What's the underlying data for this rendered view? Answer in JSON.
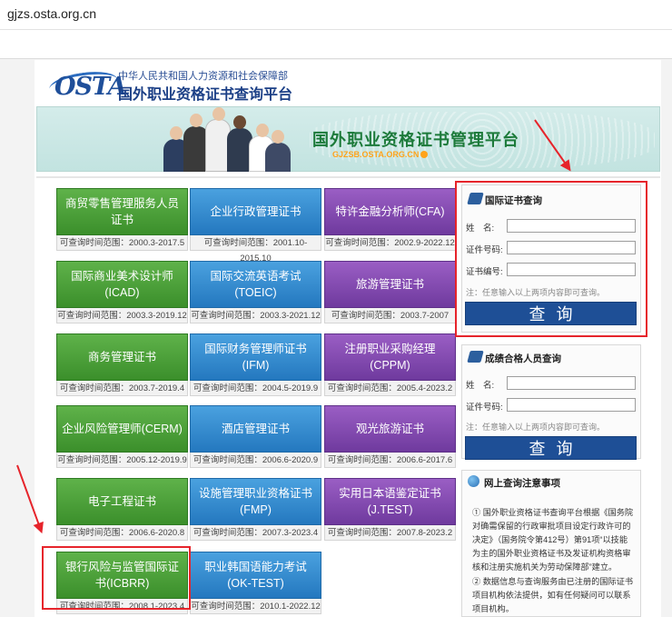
{
  "browser": {
    "url": "gjzs.osta.org.cn"
  },
  "header": {
    "logo_text": "OSTA",
    "department": "中华人民共和国人力资源和社会保障部",
    "platform": "国外职业资格证书查询平台"
  },
  "banner": {
    "title": "国外职业资格证书管理平台",
    "url": "GJZSB.OSTA.ORG.CN"
  },
  "tiles": [
    {
      "label": "商贸零售管理服务人员证书",
      "range": "可查询时间范围：2000.3-2017.5",
      "color": "green"
    },
    {
      "label": "企业行政管理证书",
      "range": "可查询时间范围：2001.10-2015.10",
      "color": "blue"
    },
    {
      "label": "特许金融分析师(CFA)",
      "range": "可查询时间范围：2002.9-2022.12",
      "color": "purple"
    },
    {
      "label": "国际商业美术设计师(ICAD)",
      "range": "可查询时间范围：2003.3-2019.12",
      "color": "green"
    },
    {
      "label": "国际交流英语考试(TOEIC)",
      "range": "可查询时间范围：2003.3-2021.12",
      "color": "blue"
    },
    {
      "label": "旅游管理证书",
      "range": "可查询时间范围：2003.7-2007",
      "color": "purple"
    },
    {
      "label": "商务管理证书",
      "range": "可查询时间范围：2003.7-2019.4",
      "color": "green"
    },
    {
      "label": "国际财务管理师证书(IFM)",
      "range": "可查询时间范围：2004.5-2019.9",
      "color": "blue"
    },
    {
      "label": "注册职业采购经理(CPPM)",
      "range": "可查询时间范围：2005.4-2023.2",
      "color": "purple"
    },
    {
      "label": "企业风险管理师(CERM)",
      "range": "可查询时间范围：2005.12-2019.9",
      "color": "green"
    },
    {
      "label": "酒店管理证书",
      "range": "可查询时间范围：2006.6-2020.9",
      "color": "blue"
    },
    {
      "label": "观光旅游证书",
      "range": "可查询时间范围：2006.6-2017.6",
      "color": "purple"
    },
    {
      "label": "电子工程证书",
      "range": "可查询时间范围：2006.6-2020.8",
      "color": "green"
    },
    {
      "label": "设施管理职业资格证书(FMP)",
      "range": "可查询时间范围：2007.3-2023.4",
      "color": "blue"
    },
    {
      "label": "实用日本语鉴定证书(J.TEST)",
      "range": "可查询时间范围：2007.8-2023.2",
      "color": "purple"
    },
    {
      "label": "银行风险与监管国际证书(ICBRR)",
      "range": "可查询时间范围：2008.1-2023.4",
      "color": "green"
    },
    {
      "label": "职业韩国语能力考试(OK-TEST)",
      "range": "可查询时间范围：2010.1-2022.12",
      "color": "blue"
    }
  ],
  "cert_query": {
    "title": "国际证书查询",
    "name_label": "姓　名:",
    "id_label": "证件号码:",
    "cert_label": "证书编号:",
    "note": "注：任意输入以上两项内容即可查询。",
    "button": "查询"
  },
  "score_query": {
    "title": "成绩合格人员查询",
    "name_label": "姓　名:",
    "id_label": "证件号码:",
    "note": "注：任意输入以上两项内容即可查询。",
    "button": "查询"
  },
  "notice": {
    "title": "网上查询注意事项",
    "item1": "① 国外职业资格证书查询平台根据《国务院对确需保留的行政审批项目设定行政许可的决定》（国务院令第412号）第91项“以技能为主的国外职业资格证书及发证机构资格审核和注册实施机关为劳动保障部”建立。",
    "item2": "② 数据信息与查询服务由已注册的国际证书项目机构依法提供，如有任何疑问可以联系项目机构。"
  },
  "colors": {
    "highlight": "#e6242b",
    "button": "#1e4f96",
    "green": "#4aa23a",
    "blue": "#3389d0",
    "purple": "#8350b0"
  }
}
